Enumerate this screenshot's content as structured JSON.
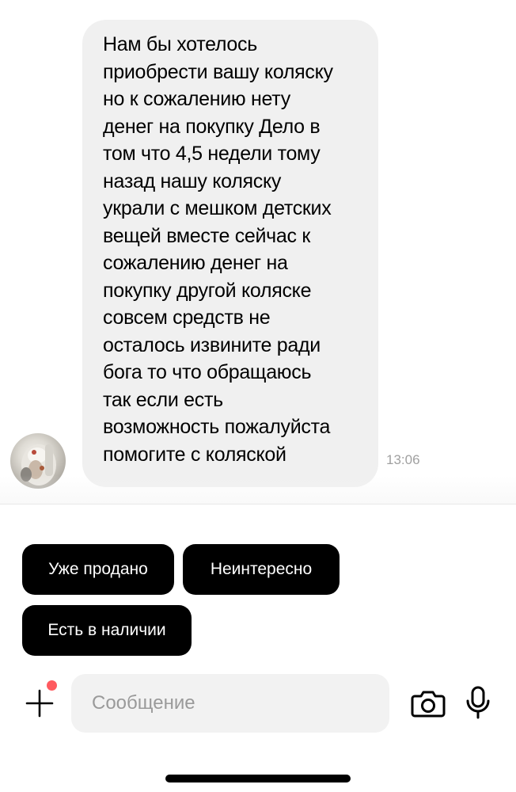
{
  "message": {
    "text": "Нам бы хотелось\nприобрести вашу коляску\nно к сожалению нету\nденег на покупку Дело в\nтом что 4,5 недели тому\nназад нашу коляску\nукрали с мешком детских\nвещей вместе сейчас к\nсожалению денег на\nпокупку другой коляске\nсовсем средств не\nосталось извините ради\nбога то что обращаюсь\nтак если есть\nвозможность пожалуйста\nпомогите с коляской",
    "time": "13:06"
  },
  "quick_replies": [
    "Уже продано",
    "Неинтересно",
    "Есть в наличии"
  ],
  "composer": {
    "placeholder": "Сообщение",
    "value": ""
  },
  "icons": {
    "add": "plus-icon",
    "camera": "camera-icon",
    "mic": "microphone-icon"
  },
  "colors": {
    "bubble": "#f0f0f0",
    "chip": "#000000",
    "badge": "#ff5a5f"
  }
}
